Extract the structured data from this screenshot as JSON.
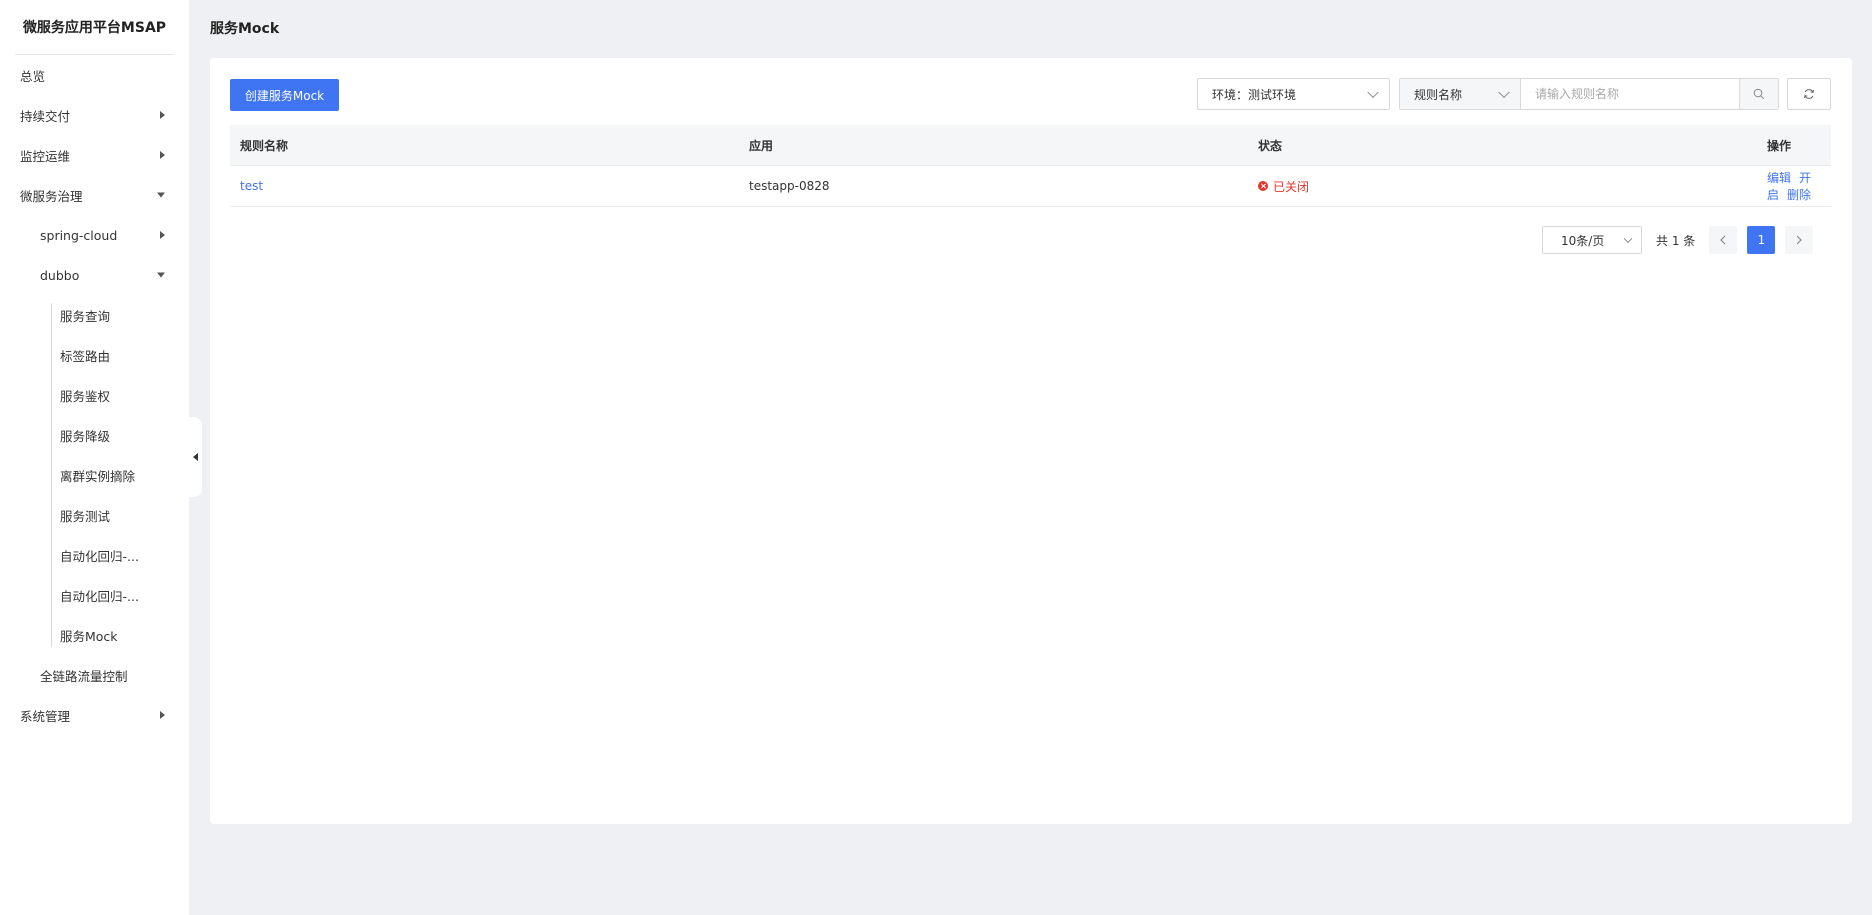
{
  "app": {
    "title": "微服务应用平台MSAP"
  },
  "sidebar": {
    "items": [
      {
        "label": "总览"
      },
      {
        "label": "持续交付"
      },
      {
        "label": "监控运维"
      },
      {
        "label": "微服务治理"
      },
      {
        "label": "spring-cloud"
      },
      {
        "label": "dubbo"
      },
      {
        "label": "服务查询"
      },
      {
        "label": "标签路由"
      },
      {
        "label": "服务鉴权"
      },
      {
        "label": "服务降级"
      },
      {
        "label": "离群实例摘除"
      },
      {
        "label": "服务测试"
      },
      {
        "label": "自动化回归-..."
      },
      {
        "label": "自动化回归-..."
      },
      {
        "label": "服务Mock"
      },
      {
        "label": "全链路流量控制"
      },
      {
        "label": "系统管理"
      }
    ]
  },
  "page": {
    "title": "服务Mock"
  },
  "toolbar": {
    "create_label": "创建服务Mock",
    "env_label": "环境：测试环境",
    "field_label": "规则名称",
    "search_placeholder": "请输入规则名称"
  },
  "table": {
    "headers": [
      "规则名称",
      "应用",
      "状态",
      "操作"
    ],
    "rows": [
      {
        "name": "test",
        "app": "testapp-0828",
        "status": "已关闭",
        "actions": [
          "编辑",
          "开启",
          "删除"
        ]
      }
    ]
  },
  "pagination": {
    "page_size": "10条/页",
    "total": "共 1 条",
    "current": "1"
  },
  "colors": {
    "primary": "#3f75f2",
    "danger": "#e0382c"
  }
}
